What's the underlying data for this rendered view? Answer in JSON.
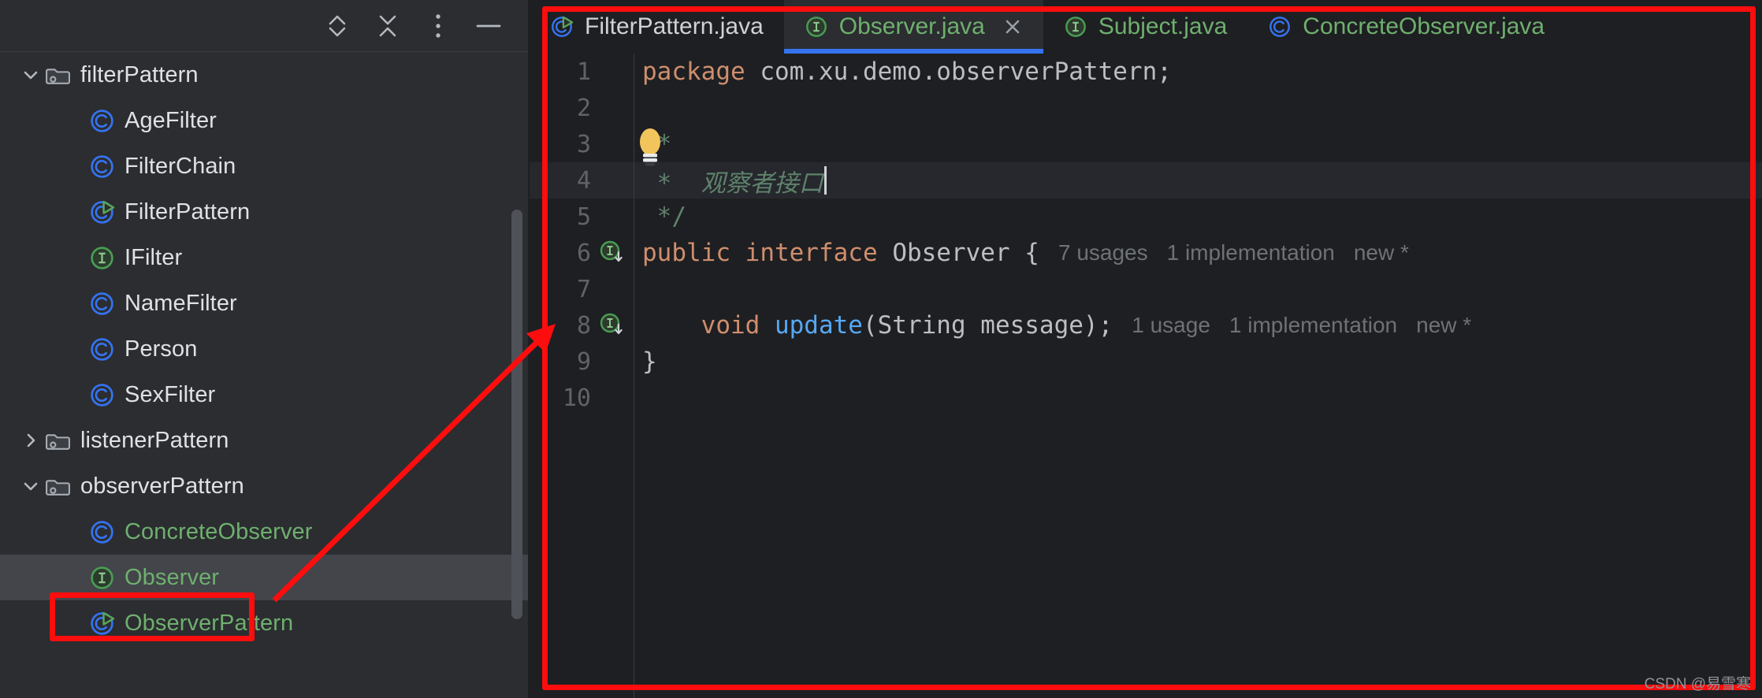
{
  "project_panel": {
    "toolbar": [
      {
        "name": "expand-all-icon",
        "label": "Expand All"
      },
      {
        "name": "collapse-all-icon",
        "label": "Collapse All"
      },
      {
        "name": "more-options-icon",
        "label": "Options"
      },
      {
        "name": "hide-panel-icon",
        "label": "Hide"
      }
    ],
    "tree": [
      {
        "label": "filterPattern",
        "icon": "folder-icon",
        "depth": 0,
        "arrow": "down",
        "selected": false,
        "modified": false
      },
      {
        "label": "AgeFilter",
        "icon": "java-class-icon",
        "depth": 1,
        "arrow": "none",
        "selected": false,
        "modified": false
      },
      {
        "label": "FilterChain",
        "icon": "java-class-icon",
        "depth": 1,
        "arrow": "none",
        "selected": false,
        "modified": false
      },
      {
        "label": "FilterPattern",
        "icon": "java-runnable-icon",
        "depth": 1,
        "arrow": "none",
        "selected": false,
        "modified": false
      },
      {
        "label": "IFilter",
        "icon": "java-interface-icon",
        "depth": 1,
        "arrow": "none",
        "selected": false,
        "modified": false
      },
      {
        "label": "NameFilter",
        "icon": "java-class-icon",
        "depth": 1,
        "arrow": "none",
        "selected": false,
        "modified": false
      },
      {
        "label": "Person",
        "icon": "java-class-icon",
        "depth": 1,
        "arrow": "none",
        "selected": false,
        "modified": false
      },
      {
        "label": "SexFilter",
        "icon": "java-class-icon",
        "depth": 1,
        "arrow": "none",
        "selected": false,
        "modified": false
      },
      {
        "label": "listenerPattern",
        "icon": "folder-icon",
        "depth": 0,
        "arrow": "right",
        "selected": false,
        "modified": false
      },
      {
        "label": "observerPattern",
        "icon": "folder-icon",
        "depth": 0,
        "arrow": "down",
        "selected": false,
        "modified": false
      },
      {
        "label": "ConcreteObserver",
        "icon": "java-class-icon",
        "depth": 1,
        "arrow": "none",
        "selected": false,
        "modified": true
      },
      {
        "label": "Observer",
        "icon": "java-interface-icon",
        "depth": 1,
        "arrow": "none",
        "selected": true,
        "modified": true
      },
      {
        "label": "ObserverPattern",
        "icon": "java-runnable-icon",
        "depth": 1,
        "arrow": "none",
        "selected": false,
        "modified": true
      }
    ]
  },
  "editor": {
    "tabs": [
      {
        "label": "FilterPattern.java",
        "icon": "java-runnable-icon",
        "active": false,
        "modified": false,
        "closable": false
      },
      {
        "label": "Observer.java",
        "icon": "java-interface-icon",
        "active": true,
        "modified": true,
        "closable": true
      },
      {
        "label": "Subject.java",
        "icon": "java-interface-icon",
        "active": false,
        "modified": true,
        "closable": false
      },
      {
        "label": "ConcreteObserver.java",
        "icon": "java-class-icon",
        "active": false,
        "modified": true,
        "closable": false
      }
    ],
    "lines": [
      {
        "no": "1",
        "gutter": "none",
        "caret": false
      },
      {
        "no": "2",
        "gutter": "none",
        "caret": false
      },
      {
        "no": "3",
        "gutter": "none",
        "caret": false
      },
      {
        "no": "4",
        "gutter": "none",
        "caret": true
      },
      {
        "no": "5",
        "gutter": "none",
        "caret": false
      },
      {
        "no": "6",
        "gutter": "implemented-icon",
        "caret": false
      },
      {
        "no": "7",
        "gutter": "none",
        "caret": false
      },
      {
        "no": "8",
        "gutter": "implemented-icon",
        "caret": false
      },
      {
        "no": "9",
        "gutter": "none",
        "caret": false
      },
      {
        "no": "10",
        "gutter": "none",
        "caret": false
      }
    ],
    "code": {
      "l1_kw": "package",
      "l1_rest": " com.xu.demo.observerPattern;",
      "l3_open": "/",
      "l3_star": "*",
      "l4": " *  观察者接口",
      "l5": " */",
      "l6_kw1": "public",
      "l6_kw2": "interface",
      "l6_name": "Observer",
      "l6_brace": "{",
      "l6_hint_usages": "7 usages",
      "l6_hint_impl": "1 implementation",
      "l6_hint_new": "new *",
      "l8_kw": "void",
      "l8_method": "update",
      "l8_sig": "(String message);",
      "l8_hint_usages": "1 usage",
      "l8_hint_impl": "1 implementation",
      "l8_hint_new": "new *",
      "l9": "}"
    }
  },
  "watermark": "CSDN @易雪寒",
  "colors": {
    "panel_bg": "#2b2d30",
    "editor_bg": "#1e1f22",
    "selection_bg": "#43454a",
    "tab_active_underline": "#3574f0",
    "annotation_red": "#fd0d0d",
    "modified_green": "#6faf6f",
    "keyword_orange": "#cf8e6d",
    "comment_green": "#5f826b",
    "method_blue": "#56a8f5",
    "class_icon_blue": "#3573f0",
    "interface_icon_green": "#499c54"
  }
}
